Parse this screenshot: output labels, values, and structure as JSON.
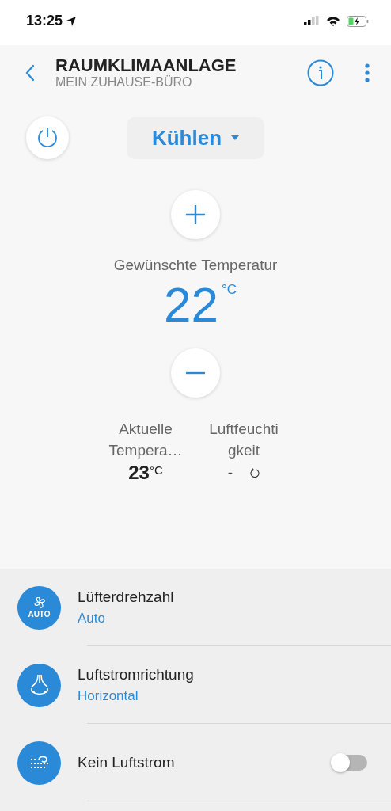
{
  "status_bar": {
    "time": "13:25"
  },
  "header": {
    "title": "RAUMKLIMAANLAGE",
    "subtitle": "MEIN ZUHAUSE-BÜRO"
  },
  "power": {
    "on": true
  },
  "mode": {
    "label": "Kühlen"
  },
  "target": {
    "label": "Gewünschte Temperatur",
    "value": "22",
    "unit": "°C"
  },
  "stats": [
    {
      "kind": "temperature",
      "label": "Aktuelle Tempera…",
      "value": "23",
      "unit": "°C"
    },
    {
      "kind": "humidity",
      "label": "Luftfeuchtigkeit",
      "value": "-"
    }
  ],
  "settings": [
    {
      "kind": "fan",
      "title": "Lüfterdrehzahl",
      "value": "Auto",
      "badge": "AUTO"
    },
    {
      "kind": "airflow",
      "title": "Luftstromrichtung",
      "value": "Horizontal"
    },
    {
      "kind": "toggle",
      "title": "Kein Luftstrom",
      "on": false
    }
  ]
}
